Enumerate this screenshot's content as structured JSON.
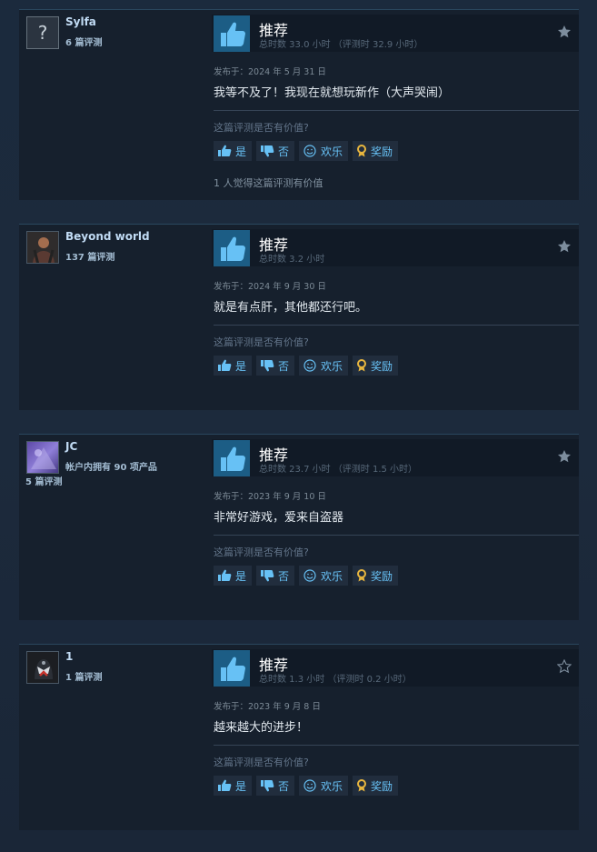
{
  "ui": {
    "recommended": "推荐",
    "posted_prefix": "发布于：",
    "helpful_question": "这篇评测是否有价值?",
    "btn_yes": "是",
    "btn_no": "否",
    "btn_funny": "欢乐",
    "btn_award": "奖励"
  },
  "reviews": [
    {
      "username": "Sylfa",
      "sub1": "6 篇评测",
      "sub2": "",
      "hours": "总时数 33.0 小时 （评测时 32.9 小时）",
      "posted": "发布于：2024 年 5 月 31 日",
      "content": "我等不及了！我现在就想玩新作（大声哭闹）",
      "found_helpful": "1 人觉得这篇评测有价值",
      "star_filled": true
    },
    {
      "username": "Beyond world",
      "sub1": "137 篇评测",
      "sub2": "",
      "hours": "总时数 3.2 小时",
      "posted": "发布于：2024 年 9 月 30 日",
      "content": "就是有点肝，其他都还行吧。",
      "found_helpful": "",
      "star_filled": true
    },
    {
      "username": "JC",
      "sub1": "帐户内拥有 90 项产品",
      "sub2": "5 篇评测",
      "hours": "总时数 23.7 小时 （评测时 1.5 小时）",
      "posted": "发布于：2023 年 9 月 10 日",
      "content": "非常好游戏，爱来自盗器",
      "found_helpful": "",
      "star_filled": true
    },
    {
      "username": "1",
      "sub1": "1 篇评测",
      "sub2": "",
      "hours": "总时数 1.3 小时 （评测时 0.2 小时）",
      "posted": "发布于：2023 年 9 月 8 日",
      "content": "越来越大的进步！",
      "found_helpful": "",
      "star_filled": false
    }
  ],
  "colors": {
    "link": "#67c1f5",
    "thumb_bg": "#1c5d85",
    "award_gold": "#e8b63e"
  }
}
